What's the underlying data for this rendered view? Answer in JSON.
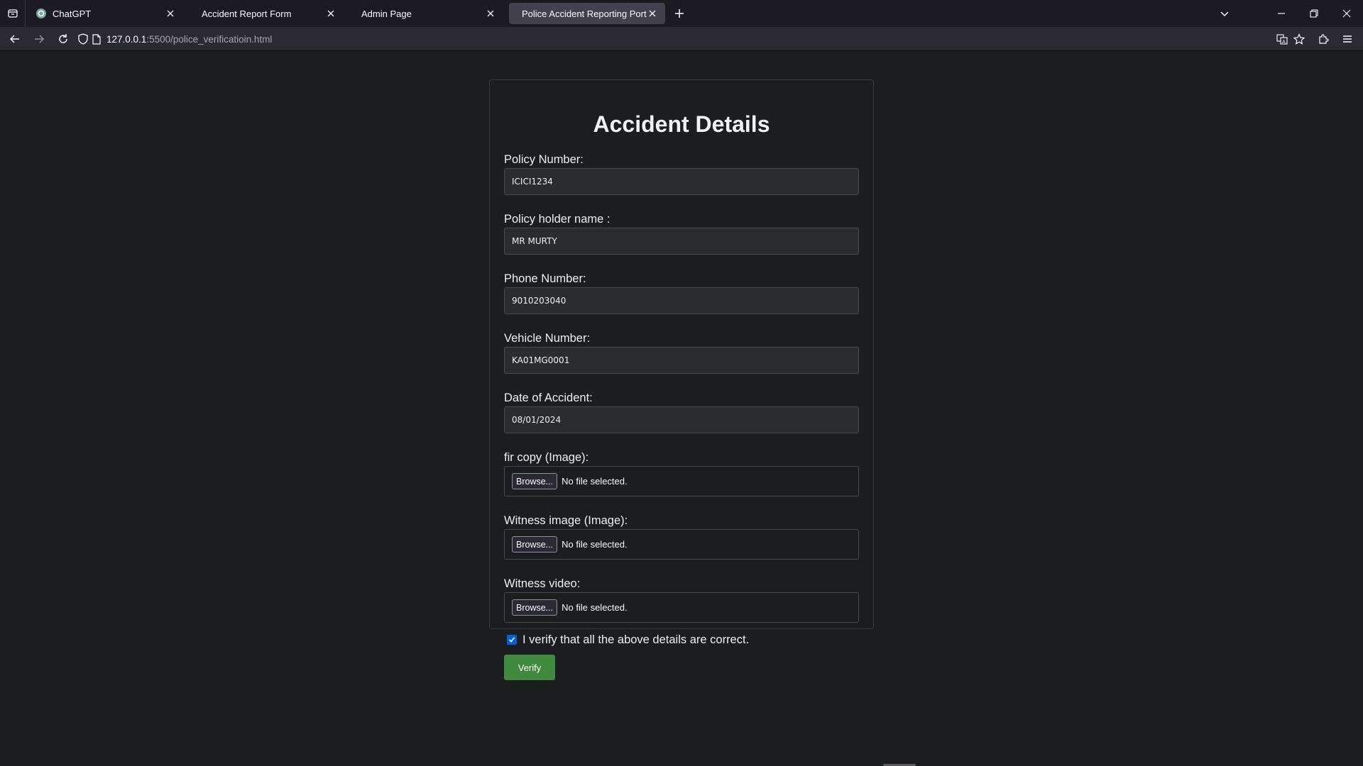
{
  "browser": {
    "tabs": [
      {
        "title": "ChatGPT",
        "active": false
      },
      {
        "title": "Accident Report Form",
        "active": false
      },
      {
        "title": "Admin Page",
        "active": false
      },
      {
        "title": "Police Accident Reporting Portal",
        "active": true
      }
    ],
    "url": {
      "host": "127.0.0.1",
      "rest": ":5500/police_verificatioin.html"
    }
  },
  "form": {
    "heading": "Accident Details",
    "policy_number": {
      "label": "Policy Number:",
      "value": "ICICI1234"
    },
    "holder_name": {
      "label": "Policy holder name :",
      "value": "MR MURTY"
    },
    "phone": {
      "label": "Phone Number:",
      "value": "9010203040"
    },
    "vehicle": {
      "label": "Vehicle Number:",
      "value": "KA01MG0001"
    },
    "date": {
      "label": "Date of Accident:",
      "value": "08/01/2024"
    },
    "fir": {
      "label": "fir copy (Image):",
      "button": "Browse...",
      "status": "No file selected."
    },
    "witness_image": {
      "label": "Witness image (Image):",
      "button": "Browse...",
      "status": "No file selected."
    },
    "witness_video": {
      "label": "Witness video:",
      "button": "Browse...",
      "status": "No file selected."
    },
    "verify_checkbox": {
      "label": "I verify that all the above details are correct.",
      "checked": true
    },
    "submit_label": "Verify"
  },
  "colors": {
    "accent": "#0060df",
    "verify_button": "#3f8b3d",
    "background": "#1c1d1f"
  }
}
